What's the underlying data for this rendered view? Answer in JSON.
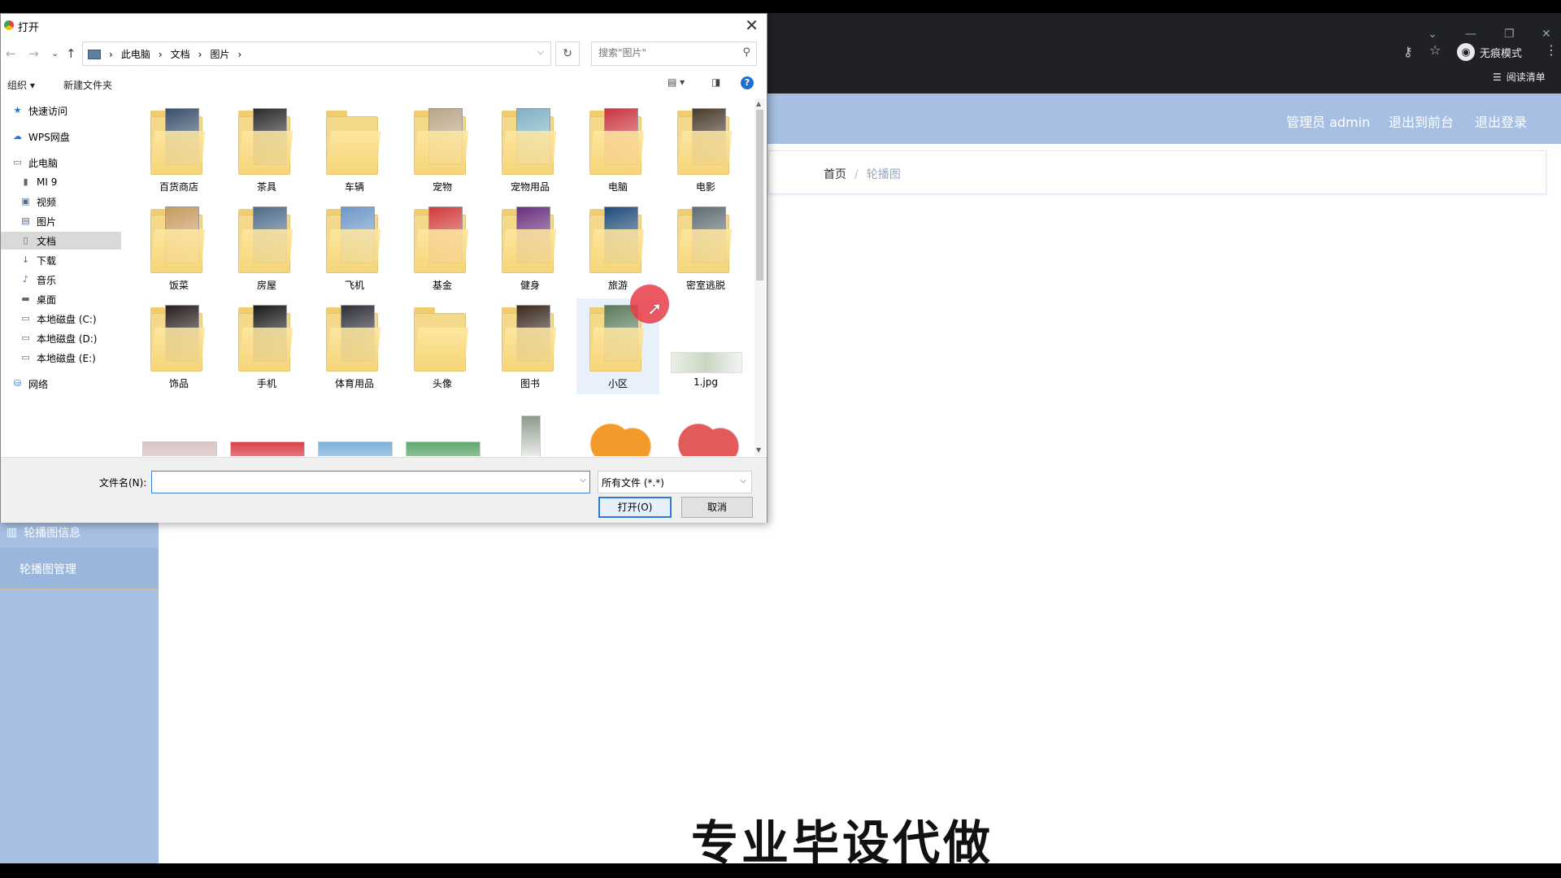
{
  "browser": {
    "incognito_label": "无痕模式",
    "reading_list_label": "阅读清单"
  },
  "app": {
    "header": {
      "admin_label": "管理员 admin",
      "front_link": "退出到前台",
      "logout_link": "退出登录",
      "background_color": "#a6bfe2"
    },
    "breadcrumb": {
      "home": "首页",
      "separator": "/",
      "current": "轮播图"
    },
    "sidebar": {
      "group_label": "轮播图信息",
      "item_label": "轮播图管理"
    },
    "watermark": "专业毕设代做"
  },
  "dialog": {
    "title": "打开",
    "path": [
      "此电脑",
      "文档",
      "图片"
    ],
    "search_placeholder": "搜索\"图片\"",
    "commands": {
      "organize": "组织 ▾",
      "new_folder": "新建文件夹"
    },
    "nav_items": [
      {
        "label": "快速访问",
        "icon": "star-icon",
        "indent": false
      },
      {
        "label": "WPS网盘",
        "icon": "cloud-icon",
        "indent": false
      },
      {
        "label": "此电脑",
        "icon": "computer-icon",
        "indent": false
      },
      {
        "label": "MI 9",
        "icon": "phone-icon",
        "indent": true
      },
      {
        "label": "视频",
        "icon": "video-icon",
        "indent": true
      },
      {
        "label": "图片",
        "icon": "picture-icon",
        "indent": true
      },
      {
        "label": "文档",
        "icon": "document-icon",
        "indent": true,
        "selected": true
      },
      {
        "label": "下载",
        "icon": "download-icon",
        "indent": true
      },
      {
        "label": "音乐",
        "icon": "music-icon",
        "indent": true
      },
      {
        "label": "桌面",
        "icon": "desktop-icon",
        "indent": true
      },
      {
        "label": "本地磁盘 (C:)",
        "icon": "drive-icon",
        "indent": true
      },
      {
        "label": "本地磁盘 (D:)",
        "icon": "drive-icon",
        "indent": true
      },
      {
        "label": "本地磁盘 (E:)",
        "icon": "drive-icon",
        "indent": true
      },
      {
        "label": "网络",
        "icon": "network-icon",
        "indent": false
      }
    ],
    "files": [
      {
        "label": "百货商店",
        "type": "folder",
        "color": "#3a4f6b"
      },
      {
        "label": "茶具",
        "type": "folder",
        "color": "#2b2b2b"
      },
      {
        "label": "车辆",
        "type": "folder",
        "color": ""
      },
      {
        "label": "宠物",
        "type": "folder",
        "color": "#b9a585"
      },
      {
        "label": "宠物用品",
        "type": "folder",
        "color": "#7fb1c4"
      },
      {
        "label": "电脑",
        "type": "folder",
        "color": "#c9353f"
      },
      {
        "label": "电影",
        "type": "folder",
        "color": "#4a3a2c"
      },
      {
        "label": "饭菜",
        "type": "folder",
        "color": "#c79a5f"
      },
      {
        "label": "房屋",
        "type": "folder",
        "color": "#4d6c8a"
      },
      {
        "label": "飞机",
        "type": "folder",
        "color": "#6d97c7"
      },
      {
        "label": "基金",
        "type": "folder",
        "color": "#d23b3b"
      },
      {
        "label": "健身",
        "type": "folder",
        "color": "#6a2f7d"
      },
      {
        "label": "旅游",
        "type": "folder",
        "color": "#1f4d7a"
      },
      {
        "label": "密室逃脱",
        "type": "folder",
        "color": "#5f6c73"
      },
      {
        "label": "饰品",
        "type": "folder",
        "color": "#2a1e1e"
      },
      {
        "label": "手机",
        "type": "folder",
        "color": "#1a1a1a"
      },
      {
        "label": "体育用品",
        "type": "folder",
        "color": "#2e3038"
      },
      {
        "label": "头像",
        "type": "folder",
        "color": ""
      },
      {
        "label": "图书",
        "type": "folder",
        "color": "#3b2a1f"
      },
      {
        "label": "小区",
        "type": "folder",
        "color": "#5b7a5a"
      },
      {
        "label": "1.jpg",
        "type": "image",
        "color": "#c9d7c0"
      }
    ],
    "partial_row_colors": [
      "#d8c3c3",
      "#d9424a",
      "#7db0d8",
      "#5fa86e",
      "#8b9a8a",
      "#f39a2a",
      "#e35a5a"
    ],
    "filename_label": "文件名(N):",
    "filename_value": "",
    "filetype_value": "所有文件 (*.*)",
    "open_button": "打开(O)",
    "cancel_button": "取消"
  }
}
